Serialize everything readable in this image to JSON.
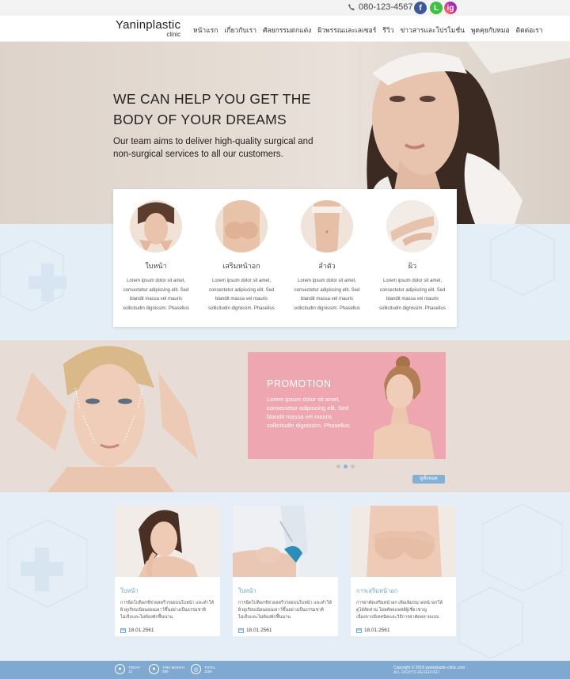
{
  "topbar": {
    "phone": "080-123-4567",
    "facebook": "f",
    "line": "L",
    "instagram": "ig"
  },
  "header": {
    "logo_main": "Yaninplastic",
    "logo_sub": "clinic",
    "nav": [
      "หน้าแรก",
      "เกี่ยวกับเรา",
      "ศัลยกรรมตกแต่ง",
      "ผิวพรรณและเลเซอร์",
      "รีวิว",
      "ข่าวสารและโปรโมชั่น",
      "พูดคุยกับหมอ",
      "ติดต่อเรา"
    ]
  },
  "hero": {
    "title_line1": "WE CAN HELP YOU GET THE",
    "title_line2": "BODY OF YOUR DREAMS",
    "subtitle_line1": "Our team aims to deliver high-quality surgical and",
    "subtitle_line2": "non-surgical services to all our customers."
  },
  "services": [
    {
      "title": "ใบหน้า",
      "text": [
        "Lorem ipsum dolor sit amet,",
        "consectetur adipiscing elit. Sed",
        "blandit massa vel mauris",
        "sollicitudin dignissim. Phasellus"
      ]
    },
    {
      "title": "เสริมหน้าอก",
      "text": [
        "Lorem ipsum dolor sit amet,",
        "consectetur adipiscing elit. Sed",
        "blandit massa vel mauris",
        "sollicitudin dignissim. Phasellus"
      ]
    },
    {
      "title": "ลำตัว",
      "text": [
        "Lorem ipsum dolor sit amet,",
        "consectetur adipiscing elit. Sed",
        "blandit massa vel mauris",
        "sollicitudin dignissim. Phasellus"
      ]
    },
    {
      "title": "ผิว",
      "text": [
        "Lorem ipsum dolor sit amet,",
        "consectetur adipiscing elit. Sed",
        "blandit massa vel mauris",
        "sollicitudin dignissim. Phasellus"
      ]
    }
  ],
  "promo": {
    "title": "PROMOTION",
    "text": [
      "Lorem ipsum dolor sit amet,",
      "consectetur adipiscing elit. Sed",
      "blandit massa vel mauris",
      "sollicitudin dignissim. Phasellus"
    ],
    "more_button": "ดูทั้งหมด"
  },
  "articles": [
    {
      "title": "ใบหน้า",
      "text": [
        "การฉีดโบท็อกซ์ช่วยลดริ้วรอยบนใบหน้า และทำให้",
        "ผิวดูเรียบเนียนอ่อนเยาว์ขึ้นอย่างเป็นธรรมชาติ",
        "ไม่เจ็บและไม่ต้องพักฟื้นนาน"
      ],
      "date": "18.01.2561"
    },
    {
      "title": "ใบหน้า",
      "text": [
        "การฉีดโบท็อกซ์ช่วยลดริ้วรอยบนใบหน้า และทำให้",
        "ผิวดูเรียบเนียนอ่อนเยาว์ขึ้นอย่างเป็นธรรมชาติ",
        "ไม่เจ็บและไม่ต้องพักฟื้นนาน"
      ],
      "date": "18.01.2561"
    },
    {
      "title": "การเสริมหน้าอก",
      "text": [
        "การผ่าตัดเสริมหน้าอก เพื่อเพิ่มขนาดหน้าอกให้",
        "ดูได้สัดส่วน โดยศัลยแพทย์ผู้เชี่ยวชาญ",
        "เนื่องจากมีเทคนิคและวิธีการผ่าตัดหลายแบบ"
      ],
      "date": "18.01.2561"
    }
  ],
  "footer": {
    "stats": [
      {
        "label": "TODAY",
        "value": "12"
      },
      {
        "label": "THIS MONTH",
        "value": "250"
      },
      {
        "label": "TOTAL",
        "value": "1158"
      }
    ],
    "copyright": "Copyright © 2018 yaninplastic-clinic.com",
    "copyright_sub": "ALL RIGHTS RESERVED"
  }
}
